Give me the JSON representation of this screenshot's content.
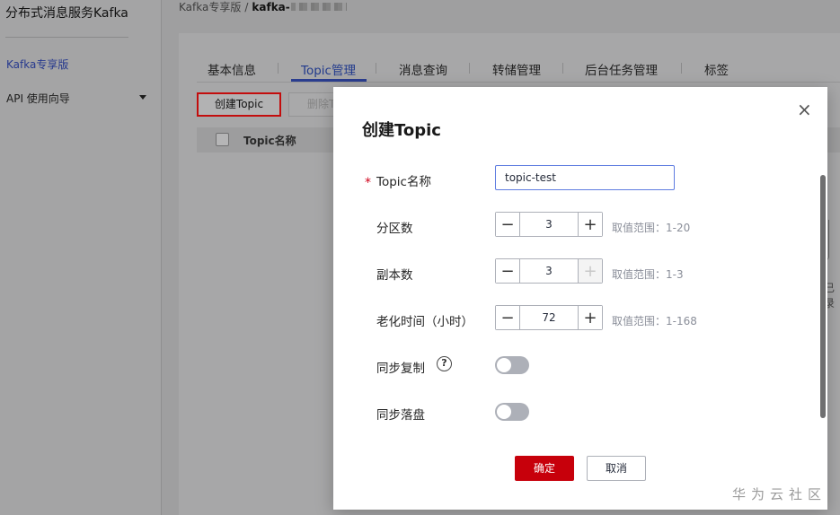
{
  "sidebar": {
    "title": "分布式消息服务Kafka",
    "items": [
      {
        "label": "Kafka专享版"
      },
      {
        "label": "API 使用向导"
      }
    ]
  },
  "breadcrumb": {
    "parent": "Kafka专享版",
    "separator": "/",
    "current": "kafka-"
  },
  "tabs": [
    {
      "label": "基本信息"
    },
    {
      "label": "Topic管理"
    },
    {
      "label": "消息查询"
    },
    {
      "label": "转储管理"
    },
    {
      "label": "后台任务管理"
    },
    {
      "label": "标签"
    }
  ],
  "toolbar": {
    "create_label": "创建Topic",
    "delete_label": "删除T"
  },
  "table": {
    "columns": [
      "Topic名称"
    ]
  },
  "background_text": "已录",
  "modal": {
    "title": "创建Topic",
    "close_icon": "close-icon",
    "fields": {
      "topic_name": {
        "required_mark": "*",
        "label": "Topic名称",
        "value": "topic-test"
      },
      "partitions": {
        "label": "分区数",
        "value": "3",
        "minus": "−",
        "plus": "+",
        "hint": "取值范围：1-20"
      },
      "replicas": {
        "label": "副本数",
        "value": "3",
        "minus": "−",
        "plus": "+",
        "hint": "取值范围：1-3"
      },
      "aging_time": {
        "label": "老化时间（小时）",
        "value": "72",
        "minus": "−",
        "plus": "+",
        "hint": "取值范围：1-168"
      },
      "sync_replication": {
        "label": "同步复制",
        "help": "?",
        "enabled": false
      },
      "sync_flush": {
        "label": "同步落盘",
        "enabled": false
      }
    },
    "ok_label": "确定",
    "cancel_label": "取消"
  },
  "watermark": "华为云社区",
  "colors": {
    "primary_red": "#c7000b",
    "accent_blue": "#5e7ce0",
    "tab_active": "#213a8c"
  }
}
